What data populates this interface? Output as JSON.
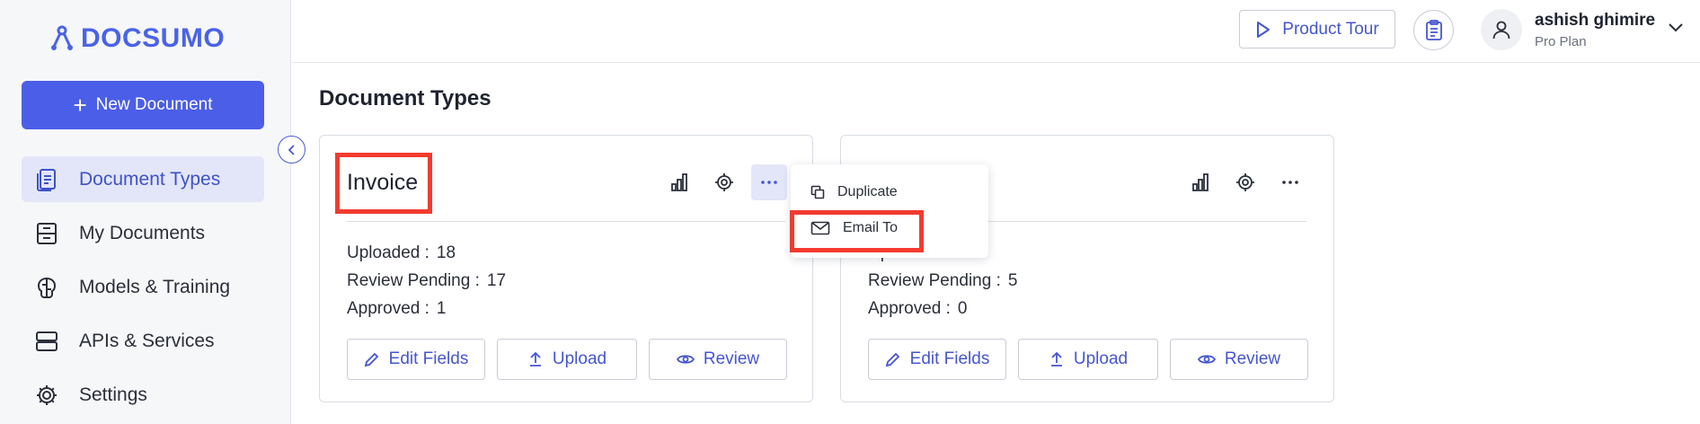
{
  "brand": {
    "name": "DOCSUMO",
    "color": "#4a63e7"
  },
  "sidebar": {
    "new_document_label": "New Document",
    "items": [
      {
        "label": "Document Types",
        "icon": "document-types-icon",
        "active": true
      },
      {
        "label": "My Documents",
        "icon": "inbox-icon",
        "active": false
      },
      {
        "label": "Models & Training",
        "icon": "brain-icon",
        "active": false
      },
      {
        "label": "APIs & Services",
        "icon": "server-icon",
        "active": false
      },
      {
        "label": "Settings",
        "icon": "gear-icon",
        "active": false
      }
    ]
  },
  "topbar": {
    "product_tour_label": "Product Tour",
    "user": {
      "name": "ashish ghimire",
      "plan": "Pro Plan"
    }
  },
  "main": {
    "title": "Document Types",
    "cards": [
      {
        "title": "Invoice",
        "stats": [
          {
            "label": "Uploaded :",
            "value": "18"
          },
          {
            "label": "Review Pending :",
            "value": "17"
          },
          {
            "label": "Approved :",
            "value": "1"
          }
        ],
        "buttons": {
          "edit": "Edit Fields",
          "upload": "Upload",
          "review": "Review"
        }
      },
      {
        "title": "",
        "stats": [
          {
            "label": "Uploaded :",
            "value": ""
          },
          {
            "label": "Review Pending :",
            "value": "5"
          },
          {
            "label": "Approved :",
            "value": "0"
          }
        ],
        "buttons": {
          "edit": "Edit Fields",
          "upload": "Upload",
          "review": "Review"
        }
      }
    ]
  },
  "dropdown": {
    "items": [
      {
        "label": "Duplicate",
        "icon": "duplicate-icon"
      },
      {
        "label": "Email To",
        "icon": "mail-icon"
      }
    ]
  },
  "colors": {
    "accent": "#4b5ee8",
    "highlight": "#f23b2f",
    "active_bg": "#e3e6f8"
  }
}
